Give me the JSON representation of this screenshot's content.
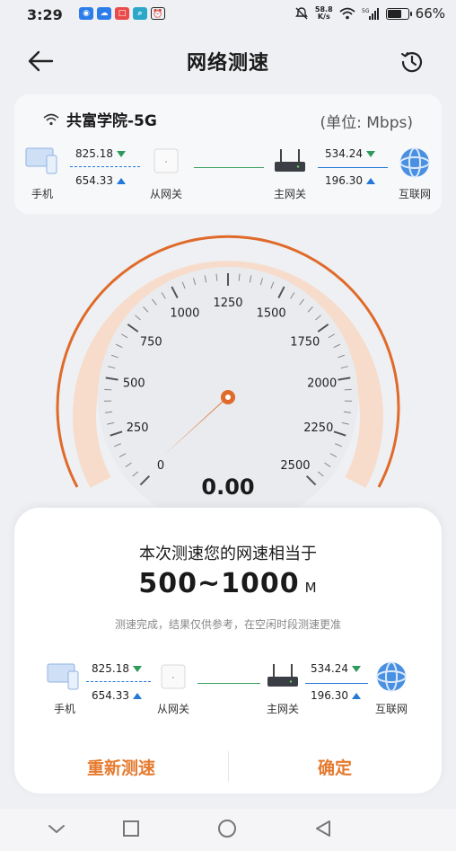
{
  "status_bar": {
    "time": "3:29",
    "net_speed_value": "58.8",
    "net_speed_unit": "K/s",
    "battery": "66%"
  },
  "header": {
    "title": "网络测速"
  },
  "network": {
    "ssid": "共富学院-5G",
    "unit": "(单位: Mbps)",
    "devices": {
      "phone": "手机",
      "sub_gateway": "从网关",
      "main_gateway": "主网关",
      "internet": "互联网"
    },
    "phone_link": {
      "download": "825.18",
      "upload": "654.33"
    },
    "gateway_link": {
      "download": "534.24",
      "upload": "196.30"
    }
  },
  "gauge": {
    "value": "0.00",
    "ticks": [
      "0",
      "250",
      "500",
      "750",
      "1000",
      "1250",
      "1500",
      "1750",
      "2000",
      "2250",
      "2500"
    ],
    "current_speed": 0
  },
  "dialog": {
    "headline": "本次测速您的网速相当于",
    "range": "500~1000",
    "range_unit": "M",
    "note": "测速完成，结果仅供参考，在空闲时段测速更准",
    "phone_link": {
      "download": "825.18",
      "upload": "654.33"
    },
    "gateway_link": {
      "download": "534.24",
      "upload": "196.30"
    },
    "devices": {
      "phone": "手机",
      "sub_gateway": "从网关",
      "main_gateway": "主网关",
      "internet": "互联网"
    },
    "retest_label": "重新测速",
    "ok_label": "确定"
  },
  "colors": {
    "accent": "#e57a2e",
    "download": "#2e9a5b",
    "upload": "#2378d8"
  }
}
